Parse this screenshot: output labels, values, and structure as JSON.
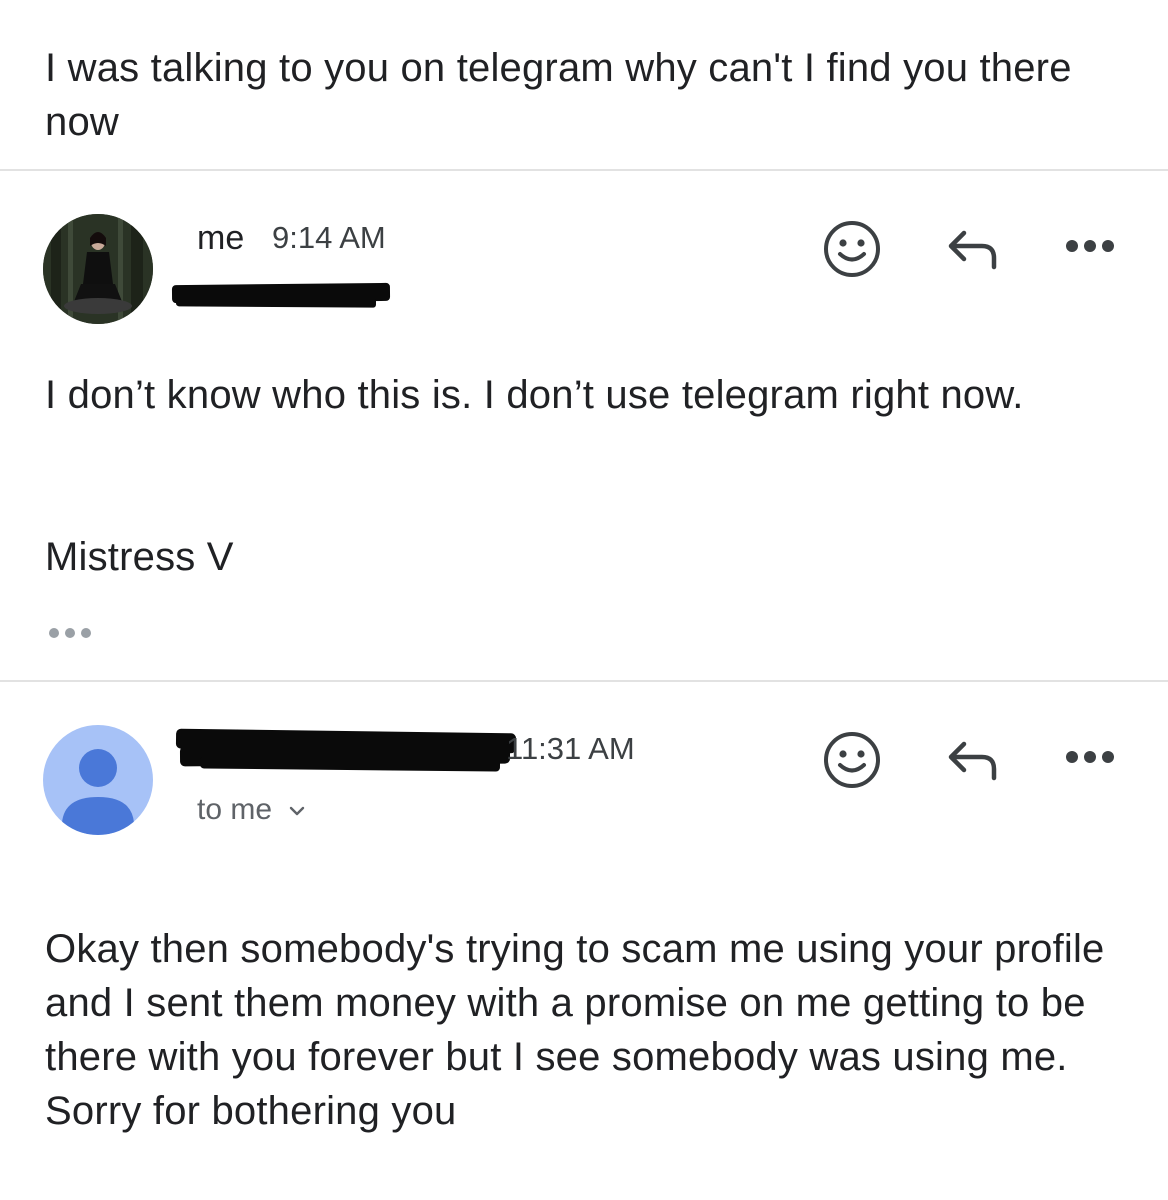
{
  "thread": {
    "first_message_tail": "I was talking to you on telegram why can't I find you there now"
  },
  "message_1": {
    "sender": "me",
    "time": "9:14 AM",
    "body": "I don’t know who this is. I don’t use telegram right now.",
    "signature": "Mistress V",
    "collapsed_quote": "•••"
  },
  "message_2": {
    "time": "11:31 AM",
    "recipient_label": "to me",
    "body": "Okay then somebody's trying to scam me using your profile and I sent them money with a promise on me getting to be there with you forever but I see somebody was using me. Sorry for bothering you"
  },
  "icons": {
    "react": "emoji-smile-icon",
    "reply": "reply-arrow-icon",
    "more": "more-horizontal-icon",
    "expand": "chevron-down-icon",
    "avatar_default": "person-icon"
  },
  "colors": {
    "text": "#202124",
    "icon": "#3c4043",
    "avatar_bg": "#a7c2f7",
    "avatar_fg": "#4a78d8",
    "divider": "#e2e2e2"
  }
}
